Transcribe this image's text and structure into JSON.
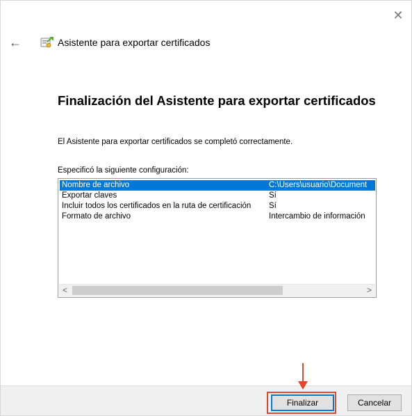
{
  "window": {
    "close_glyph": "✕",
    "back_glyph": "←",
    "wizard_icon": "certificate-wizard-icon",
    "title": "Asistente para exportar certificados"
  },
  "content": {
    "heading": "Finalización del Asistente para exportar certificados",
    "completion_text": "El Asistente para exportar certificados se completó correctamente.",
    "list_label": "Especificó la siguiente configuración:"
  },
  "settings": [
    {
      "name": "Nombre de archivo",
      "value": "C:\\Users\\usuario\\Document",
      "selected": true
    },
    {
      "name": "Exportar claves",
      "value": "Sí",
      "selected": false
    },
    {
      "name": "Incluir todos los certificados en la ruta de certificación",
      "value": "Sí",
      "selected": false
    },
    {
      "name": "Formato de archivo",
      "value": "Intercambio de información",
      "selected": false
    }
  ],
  "scrollbar": {
    "left_glyph": "<",
    "right_glyph": ">"
  },
  "footer": {
    "finish_label": "Finalizar",
    "cancel_label": "Cancelar"
  },
  "colors": {
    "selection": "#0078d7",
    "annotation": "#e5452a"
  }
}
